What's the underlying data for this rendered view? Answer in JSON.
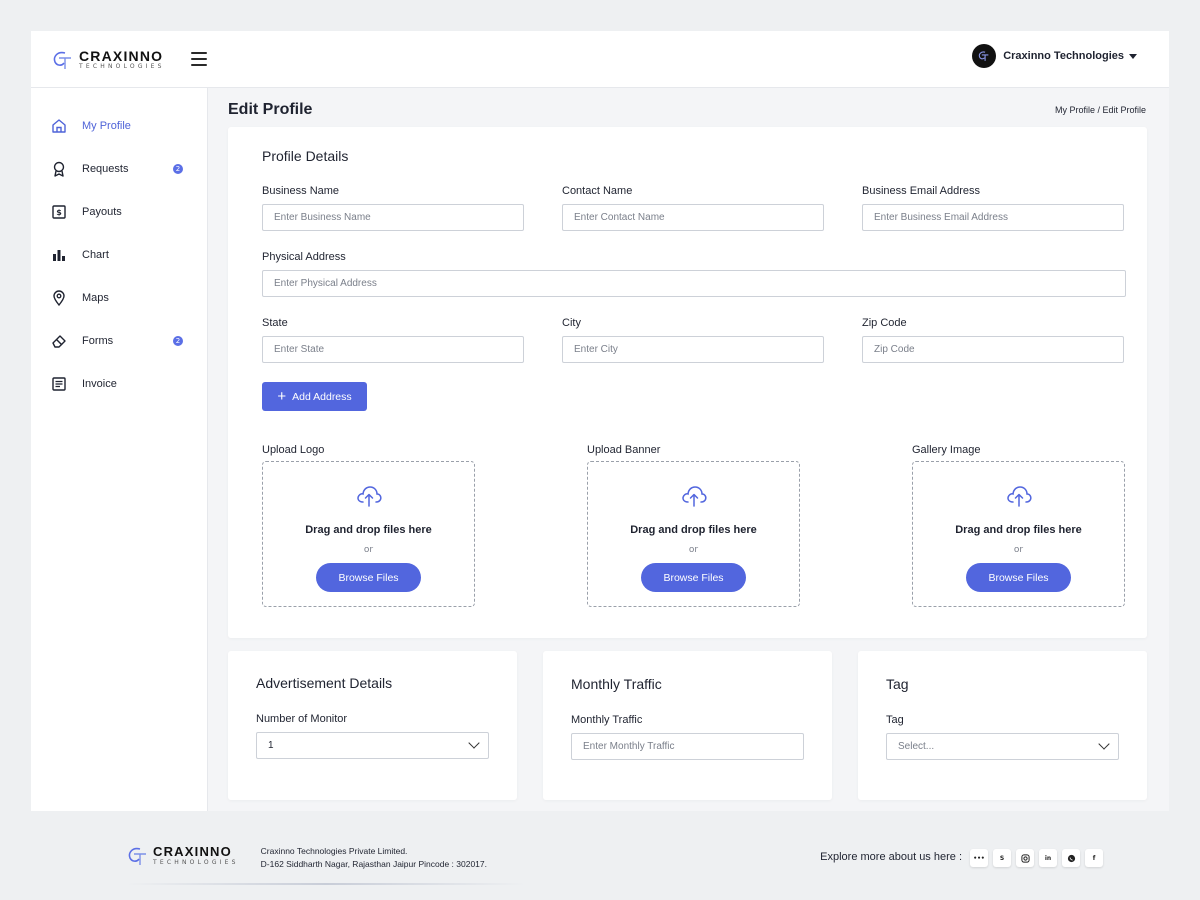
{
  "brand": {
    "name": "CRAXINNO",
    "sub": "TECHNOLOGIES"
  },
  "header": {
    "user_name": "Craxinno Technologies"
  },
  "sidebar": {
    "items": [
      {
        "label": "My Profile",
        "icon": "home-icon",
        "active": true
      },
      {
        "label": "Requests",
        "icon": "award-icon",
        "badge": "2"
      },
      {
        "label": "Payouts",
        "icon": "dollar-card-icon"
      },
      {
        "label": "Chart",
        "icon": "bar-chart-icon"
      },
      {
        "label": "Maps",
        "icon": "map-pin-icon"
      },
      {
        "label": "Forms",
        "icon": "eraser-icon",
        "badge": "2"
      },
      {
        "label": "Invoice",
        "icon": "document-list-icon"
      }
    ]
  },
  "page": {
    "title": "Edit Profile",
    "breadcrumb": "My Profile / Edit Profile"
  },
  "profile": {
    "title": "Profile Details",
    "business_name": {
      "label": "Business Name",
      "placeholder": "Enter Business Name"
    },
    "contact_name": {
      "label": "Contact Name",
      "placeholder": "Enter Contact Name"
    },
    "business_email": {
      "label": "Business Email Address",
      "placeholder": "Enter Business Email Address"
    },
    "physical_address": {
      "label": "Physical Address",
      "placeholder": "Enter Physical Address"
    },
    "state": {
      "label": "State",
      "placeholder": "Enter State"
    },
    "city": {
      "label": "City",
      "placeholder": "Enter City"
    },
    "zip": {
      "label": "Zip Code",
      "placeholder": "Zip Code"
    },
    "add_address": "Add Address"
  },
  "uploads": [
    {
      "label": "Upload Logo",
      "text": "Drag and drop files here",
      "or": "or",
      "button": "Browse Files"
    },
    {
      "label": "Upload Banner",
      "text": "Drag and drop files here",
      "or": "or",
      "button": "Browse Files"
    },
    {
      "label": "Gallery Image",
      "text": "Drag and drop files here",
      "or": "or",
      "button": "Browse Files"
    }
  ],
  "advertisement": {
    "title": "Advertisement Details",
    "label": "Number of Monitor",
    "value": "1"
  },
  "traffic": {
    "title": "Monthly Traffic",
    "label": "Monthly Traffic",
    "placeholder": "Enter Monthly Traffic"
  },
  "tag": {
    "title": "Tag",
    "label": "Tag",
    "placeholder": "Select..."
  },
  "footer": {
    "company": "Craxinno Technologies Private Limited.",
    "address": "D-162 Siddharth Nagar, Rajasthan Jaipur Pincode : 302017.",
    "explore": "Explore more about us here :",
    "socials": [
      "more-icon",
      "skype-icon",
      "instagram-icon",
      "linkedin-icon",
      "whatsapp-icon",
      "facebook-icon"
    ]
  },
  "colors": {
    "accent": "#5266de",
    "badge": "#5b6fe6",
    "active_nav": "#4f63d8"
  }
}
